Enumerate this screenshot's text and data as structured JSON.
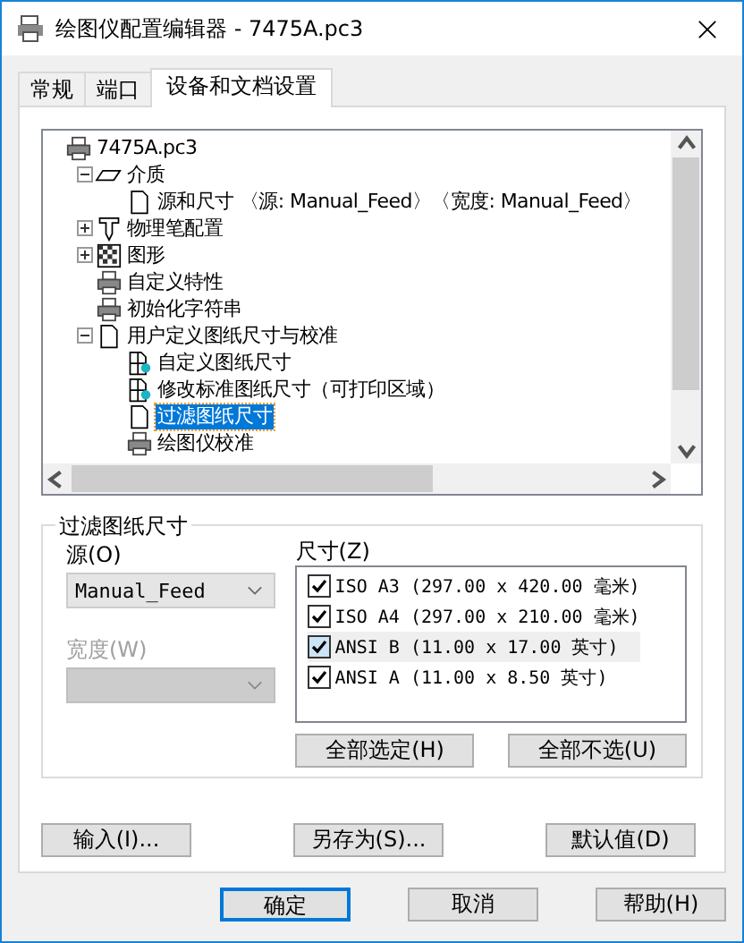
{
  "window": {
    "title": "绘图仪配置编辑器 - 7475A.pc3"
  },
  "tabs": [
    {
      "label": "常规",
      "selected": false
    },
    {
      "label": "端口",
      "selected": false
    },
    {
      "label": "设备和文档设置",
      "selected": true
    }
  ],
  "tree": [
    {
      "label": "7475A.pc3",
      "kind": "printer",
      "selected": false,
      "children": [
        {
          "label": "介质",
          "kind": "media",
          "expanded": true,
          "selected": false,
          "children": [
            {
              "label": "源和尺寸 〈源:  Manual_Feed〉〈宽度: Manual_Feed〉",
              "kind": "page",
              "selected": false
            }
          ]
        },
        {
          "label": "物理笔配置",
          "kind": "pen",
          "expanded": false,
          "selected": false
        },
        {
          "label": "图形",
          "kind": "pattern",
          "expanded": false,
          "selected": false
        },
        {
          "label": "自定义特性",
          "kind": "printer",
          "selected": false
        },
        {
          "label": "初始化字符串",
          "kind": "printer",
          "selected": false
        },
        {
          "label": "用户定义图纸尺寸与校准",
          "kind": "page",
          "expanded": true,
          "selected": false,
          "children": [
            {
              "label": "自定义图纸尺寸",
              "kind": "custom",
              "selected": false
            },
            {
              "label": "修改标准图纸尺寸（可打印区域）",
              "kind": "custom",
              "selected": false
            },
            {
              "label": "过滤图纸尺寸",
              "kind": "page",
              "selected": true
            },
            {
              "label": "绘图仪校准",
              "kind": "printer",
              "selected": false
            }
          ]
        }
      ]
    }
  ],
  "group": {
    "title": "过滤图纸尺寸",
    "source": {
      "label": "源(O)",
      "value": "Manual_Feed",
      "disabled": false
    },
    "width": {
      "label": "宽度(W)",
      "disabled": true
    },
    "sizes": {
      "label": "尺寸(Z)",
      "items": [
        {
          "label": "ISO A3 (297.00 x 420.00 毫米)",
          "checked": true,
          "selected": false
        },
        {
          "label": "ISO A4 (297.00 x 210.00 毫米)",
          "checked": true,
          "selected": false
        },
        {
          "label": "ANSI B (11.00 x 17.00 英寸)",
          "checked": true,
          "selected": true
        },
        {
          "label": "ANSI A (11.00 x 8.50 英寸)",
          "checked": true,
          "selected": false
        }
      ]
    },
    "buttons": [
      "全部选定(H)",
      "全部不选(U)"
    ]
  },
  "panel_buttons": [
    "输入(I)...",
    "另存为(S)...",
    "默认值(D)"
  ],
  "dialog_buttons": [
    {
      "label": "确定",
      "default": true
    },
    {
      "label": "取消",
      "default": false
    },
    {
      "label": "帮助(H)",
      "default": false
    }
  ]
}
